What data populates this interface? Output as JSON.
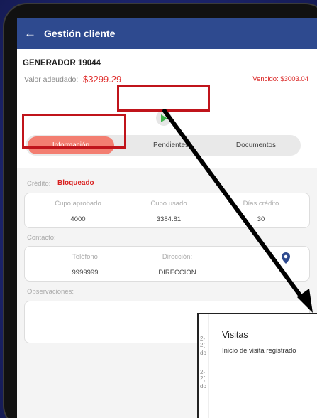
{
  "appbar": {
    "title": "Gestión cliente"
  },
  "client": {
    "name": "GENERADOR 19044",
    "debt_label": "Valor adeudado:",
    "debt_value": "$3299.29",
    "overdue": "Vencido: $3003.04"
  },
  "tabs": [
    {
      "label": "Información",
      "active": true
    },
    {
      "label": "Pendientes",
      "active": false
    },
    {
      "label": "Documentos",
      "active": false
    }
  ],
  "credit": {
    "label": "Crédito:",
    "status": "Bloqueado",
    "columns": [
      {
        "label": "Cupo aprobado",
        "value": "4000"
      },
      {
        "label": "Cupo usado",
        "value": "3384.81"
      },
      {
        "label": "Días crédito",
        "value": "30"
      }
    ]
  },
  "contact": {
    "label": "Contacto:",
    "phone_label": "Teléfono",
    "phone_value": "9999999",
    "address_label": "Dirección:",
    "address_value": "DIRECCION"
  },
  "observations": {
    "label": "Observaciones:"
  },
  "dialog": {
    "title": "Visitas",
    "message": "Inicio de visita registrado",
    "behind_text_1": "2-2(",
    "behind_text_2": "do",
    "behind_text_3": "2-2(",
    "behind_text_4": "do"
  },
  "colors": {
    "appbar": "#2e4a8f",
    "accent_red": "#e0302f",
    "active_tab": "#f37e71",
    "play_green": "#3cb44b",
    "highlight": "#c0141b",
    "pin_blue": "#2e4a8f"
  },
  "icons": {
    "back": "arrow-left-icon",
    "play": "play-icon",
    "location": "map-pin-icon"
  }
}
